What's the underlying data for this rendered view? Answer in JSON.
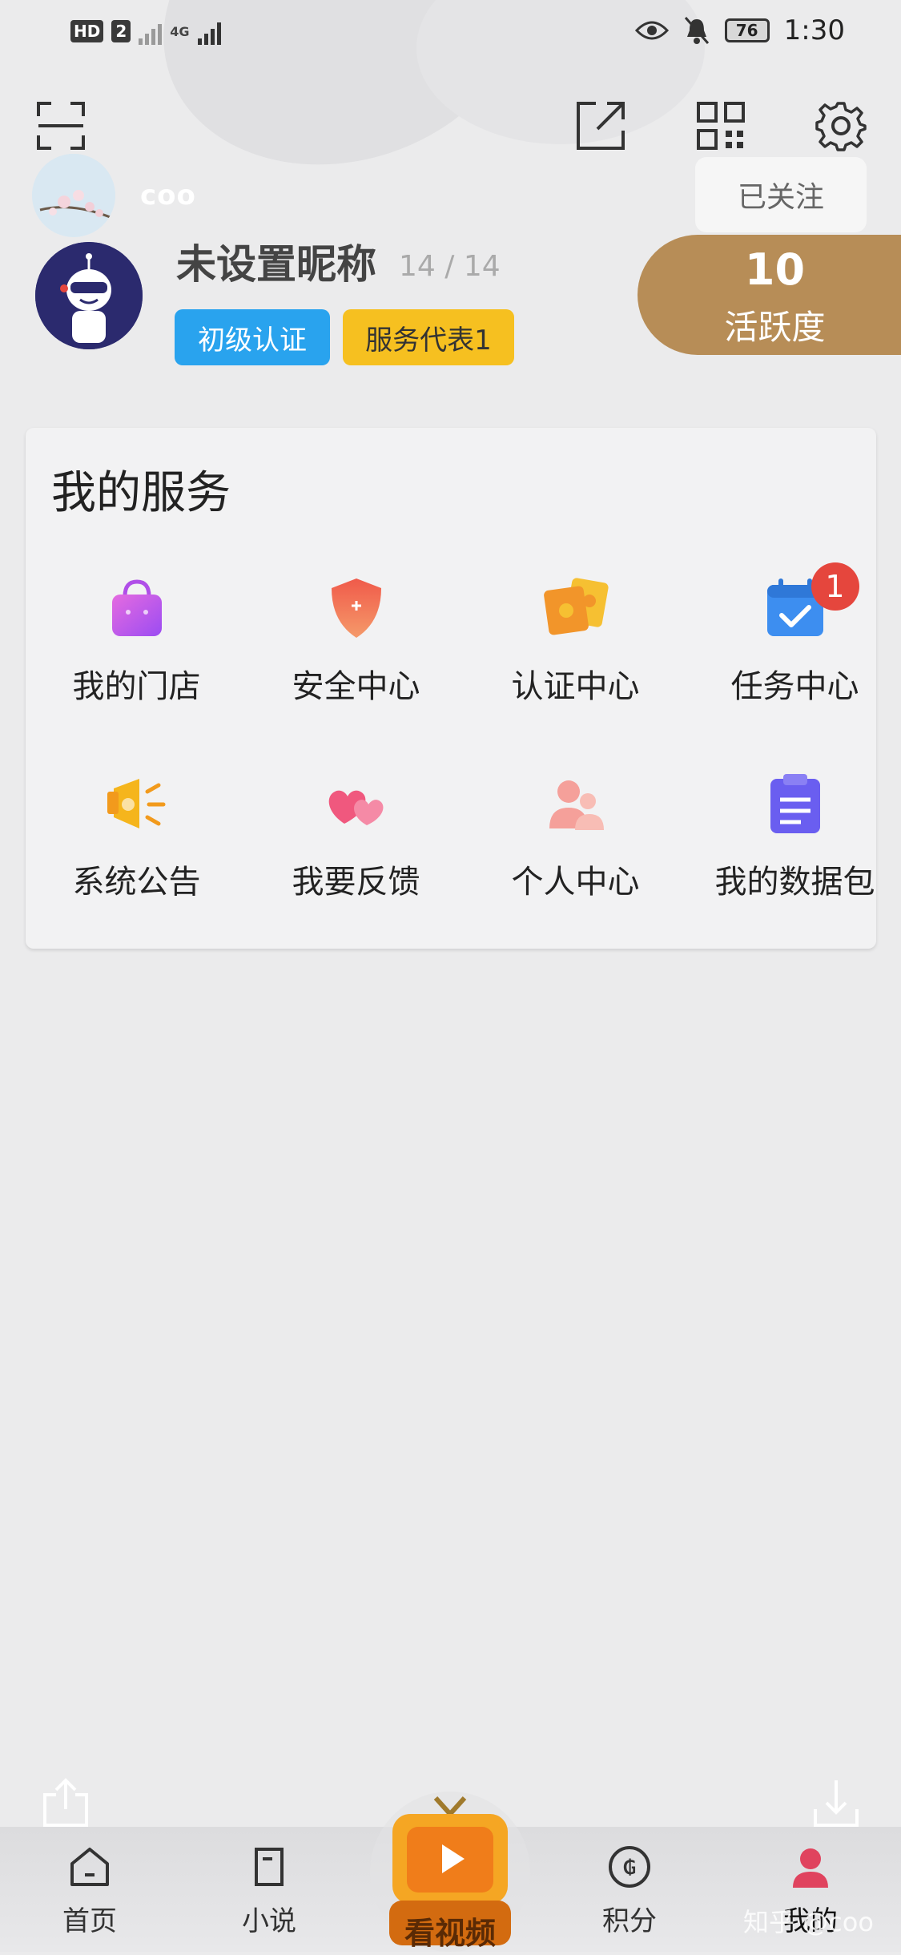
{
  "status_bar": {
    "hd_label": "HD",
    "sim2_label": "2",
    "net_label": "4G",
    "battery": "76",
    "time": "1:30",
    "icons": [
      "eye-icon",
      "bell-off-icon"
    ]
  },
  "header_icons": [
    "scan-icon",
    "share-icon",
    "qrcode-icon",
    "gear-icon"
  ],
  "profile": {
    "small_name": "coo",
    "follow_label": "已关注",
    "nickname": "未设置昵称",
    "nickname_count": "14 / 14",
    "badges": [
      "初级认证",
      "服务代表1"
    ],
    "activity_value": "10",
    "activity_label": "活跃度"
  },
  "services": {
    "title": "我的服务",
    "items": [
      {
        "label": "我的门店",
        "icon": "shopping-bag-icon",
        "color": "#c65cf0"
      },
      {
        "label": "安全中心",
        "icon": "shield-icon",
        "color": "#f0584a"
      },
      {
        "label": "认证中心",
        "icon": "certificate-icon",
        "color": "#f5a623"
      },
      {
        "label": "任务中心",
        "icon": "calendar-check-icon",
        "color": "#3d8ef0",
        "badge": "1"
      },
      {
        "label": "系统公告",
        "icon": "megaphone-icon",
        "color": "#f5b51c"
      },
      {
        "label": "我要反馈",
        "icon": "hearts-icon",
        "color": "#f0587e"
      },
      {
        "label": "个人中心",
        "icon": "users-icon",
        "color": "#f5a09a"
      },
      {
        "label": "我的数据包",
        "icon": "clipboard-icon",
        "color": "#6a5ef0"
      }
    ]
  },
  "floating": [
    "upload-icon",
    "download-icon"
  ],
  "tab_bar": {
    "tabs": [
      {
        "label": "首页",
        "icon": "home-icon"
      },
      {
        "label": "小说",
        "icon": "book-icon"
      },
      {
        "label": "看视频",
        "icon": "tv-icon"
      },
      {
        "label": "积分",
        "icon": "coin-icon"
      },
      {
        "label": "我的",
        "icon": "person-icon"
      }
    ],
    "active": "我的",
    "accent": "#e0435e"
  },
  "watermark": "知乎 @coo"
}
